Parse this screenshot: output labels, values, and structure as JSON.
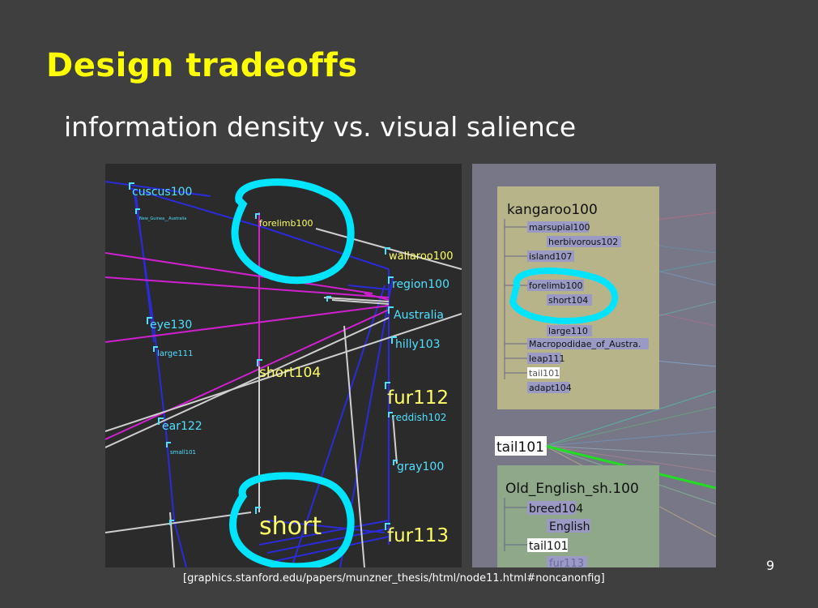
{
  "slide": {
    "title": "Design tradeoffs",
    "subtitle": "information density vs. visual salience",
    "caption": "[graphics.stanford.edu/papers/munzner_thesis/html/node11.html#noncanonfig]",
    "page_number": "9"
  },
  "left_panel": {
    "labels": {
      "cuscus": "cuscus100",
      "forelimb": "forelimb100",
      "wallaroo": "wallaroo100",
      "region": "region100",
      "australia": "Australia",
      "hilly": "hilly103",
      "eye": "eye130",
      "large": "large111",
      "short104": "short104",
      "fur112": "fur112",
      "reddish": "reddish102",
      "gray": "gray100",
      "ear": "ear122",
      "small": "small101",
      "short": "short",
      "fur113": "fur113",
      "tiny": "New_Guinea__Australia"
    }
  },
  "right_panel": {
    "box1": {
      "title": "kangaroo100",
      "items": [
        "marsupial100",
        "herbivorous102",
        "island107",
        "forelimb100",
        "short104",
        "large110",
        "Macropodidae_of_Austra.",
        "leap111",
        "tail101",
        "adapt104"
      ]
    },
    "tail_label": "tail101",
    "box2": {
      "title": "Old_English_sh.100",
      "items": [
        "breed104",
        "English",
        "tail101",
        "fur113"
      ]
    }
  },
  "colors": {
    "background": "#3f3f3f",
    "title": "#ffff00",
    "highlight": "#00e5ff"
  }
}
